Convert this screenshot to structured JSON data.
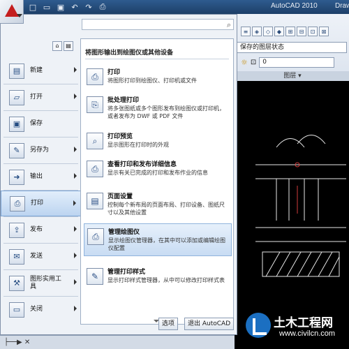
{
  "titlebar": {
    "title": "AutoCAD 2010",
    "title_right": "Draw",
    "quick_access": [
      "new-icon",
      "open-icon",
      "save-icon",
      "undo-icon",
      "redo-icon",
      "plot-icon"
    ]
  },
  "search": {
    "placeholder": "",
    "icon": "search-icon"
  },
  "ribbon": {
    "layer_state": "保存的图层状态",
    "layer_value": "0",
    "panel_label": "图层 ▾"
  },
  "menu": {
    "items": [
      {
        "label": "新建",
        "icon": "new-doc-icon",
        "has_arrow": true
      },
      {
        "label": "打开",
        "icon": "open-folder-icon",
        "has_arrow": true
      },
      {
        "label": "保存",
        "icon": "save-disk-icon",
        "has_arrow": false
      },
      {
        "label": "另存为",
        "icon": "save-as-icon",
        "has_arrow": true
      },
      {
        "label": "输出",
        "icon": "export-icon",
        "has_arrow": true
      },
      {
        "label": "打印",
        "icon": "printer-icon",
        "has_arrow": true,
        "active": true
      },
      {
        "label": "发布",
        "icon": "publish-icon",
        "has_arrow": true
      },
      {
        "label": "发送",
        "icon": "send-icon",
        "has_arrow": true
      },
      {
        "label": "图形实用工具",
        "icon": "drawing-utilities-icon",
        "has_arrow": true
      },
      {
        "label": "关闭",
        "icon": "close-folder-icon",
        "has_arrow": true
      }
    ]
  },
  "submenu": {
    "header": "将图形输出到绘图仪或其他设备",
    "items": [
      {
        "title": "打印",
        "desc": "将图形打印到绘图仪、打印机或文件",
        "icon": "printer-icon"
      },
      {
        "title": "批处理打印",
        "desc": "将多张图纸或多个图形发布到绘图仪或打印机，或者发布为 DWF 或 PDF 文件",
        "icon": "batch-plot-icon"
      },
      {
        "title": "打印预览",
        "desc": "显示图形在打印时的外观",
        "icon": "plot-preview-icon"
      },
      {
        "title": "查看打印和发布详细信息",
        "desc": "显示有关已完成的打印和发布作业的信息",
        "icon": "plot-details-icon"
      },
      {
        "title": "页面设置",
        "desc": "控制每个新布局的页面布局、打印设备、图纸尺寸以及其他设置",
        "icon": "page-setup-icon"
      },
      {
        "title": "管理绘图仪",
        "desc": "显示绘图仪管理器，在其中可以添加或编辑绘图仪配置",
        "icon": "plotter-manager-icon",
        "highlight": true
      },
      {
        "title": "管理打印样式",
        "desc": "显示打印样式管理器，从中可以修改打印样式表",
        "icon": "plot-style-manager-icon"
      }
    ]
  },
  "footer": {
    "options": "选项",
    "exit": "退出 AutoCAD"
  },
  "watermark": {
    "title": "土木工程网",
    "url": "www.civilcn.com"
  }
}
